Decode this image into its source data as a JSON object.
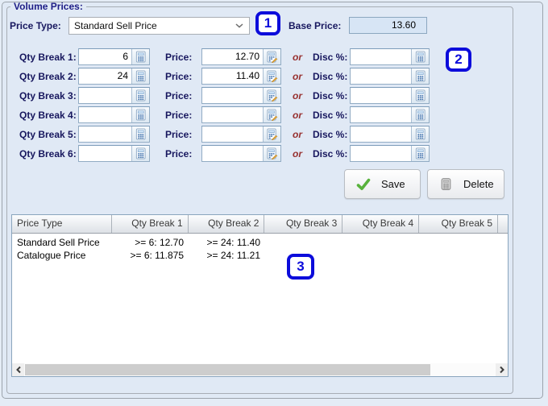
{
  "panel": {
    "legend": "Volume Prices:"
  },
  "price_type": {
    "label": "Price Type:",
    "value": "Standard Sell Price"
  },
  "base_price": {
    "label": "Base Price:",
    "value": "13.60"
  },
  "callouts": {
    "c1": "1",
    "c2": "2",
    "c3": "3"
  },
  "rows": [
    {
      "qty_label": "Qty Break 1:",
      "qty": "6",
      "price_label": "Price:",
      "price": "12.70",
      "or": "or",
      "disc_label": "Disc %:",
      "disc": ""
    },
    {
      "qty_label": "Qty Break 2:",
      "qty": "24",
      "price_label": "Price:",
      "price": "11.40",
      "or": "or",
      "disc_label": "Disc %:",
      "disc": ""
    },
    {
      "qty_label": "Qty Break 3:",
      "qty": "",
      "price_label": "Price:",
      "price": "",
      "or": "or",
      "disc_label": "Disc %:",
      "disc": ""
    },
    {
      "qty_label": "Qty Break 4:",
      "qty": "",
      "price_label": "Price:",
      "price": "",
      "or": "or",
      "disc_label": "Disc %:",
      "disc": ""
    },
    {
      "qty_label": "Qty Break 5:",
      "qty": "",
      "price_label": "Price:",
      "price": "",
      "or": "or",
      "disc_label": "Disc %:",
      "disc": ""
    },
    {
      "qty_label": "Qty Break 6:",
      "qty": "",
      "price_label": "Price:",
      "price": "",
      "or": "or",
      "disc_label": "Disc %:",
      "disc": ""
    }
  ],
  "buttons": {
    "save_label": "Save",
    "delete_label": "Delete"
  },
  "grid": {
    "columns": [
      "Price Type",
      "Qty Break 1",
      "Qty Break 2",
      "Qty Break 3",
      "Qty Break 4",
      "Qty Break 5"
    ],
    "rows": [
      [
        "Standard Sell Price",
        ">= 6: 12.70",
        ">= 24: 11.40",
        "",
        "",
        ""
      ],
      [
        "Catalogue Price",
        ">= 6: 11.875",
        ">= 24: 11.21",
        "",
        "",
        ""
      ]
    ]
  },
  "icons": {
    "qty_button": "calculator-icon",
    "price_button": "calculator-edit-icon",
    "disc_button": "calculator-icon",
    "save_button": "check-icon",
    "delete_button": "calculator-delete-icon",
    "price_type_dropdown": "chevron-down-icon",
    "scrollbar_left": "chevron-left-icon",
    "scrollbar_right": "chevron-right-icon"
  },
  "colors": {
    "accent_blue": "#0c0cdb",
    "label_navy": "#17175e",
    "or_red": "#97302f",
    "base_price_bg": "#d7e5f5",
    "panel_bg": "#e0e9f5"
  }
}
